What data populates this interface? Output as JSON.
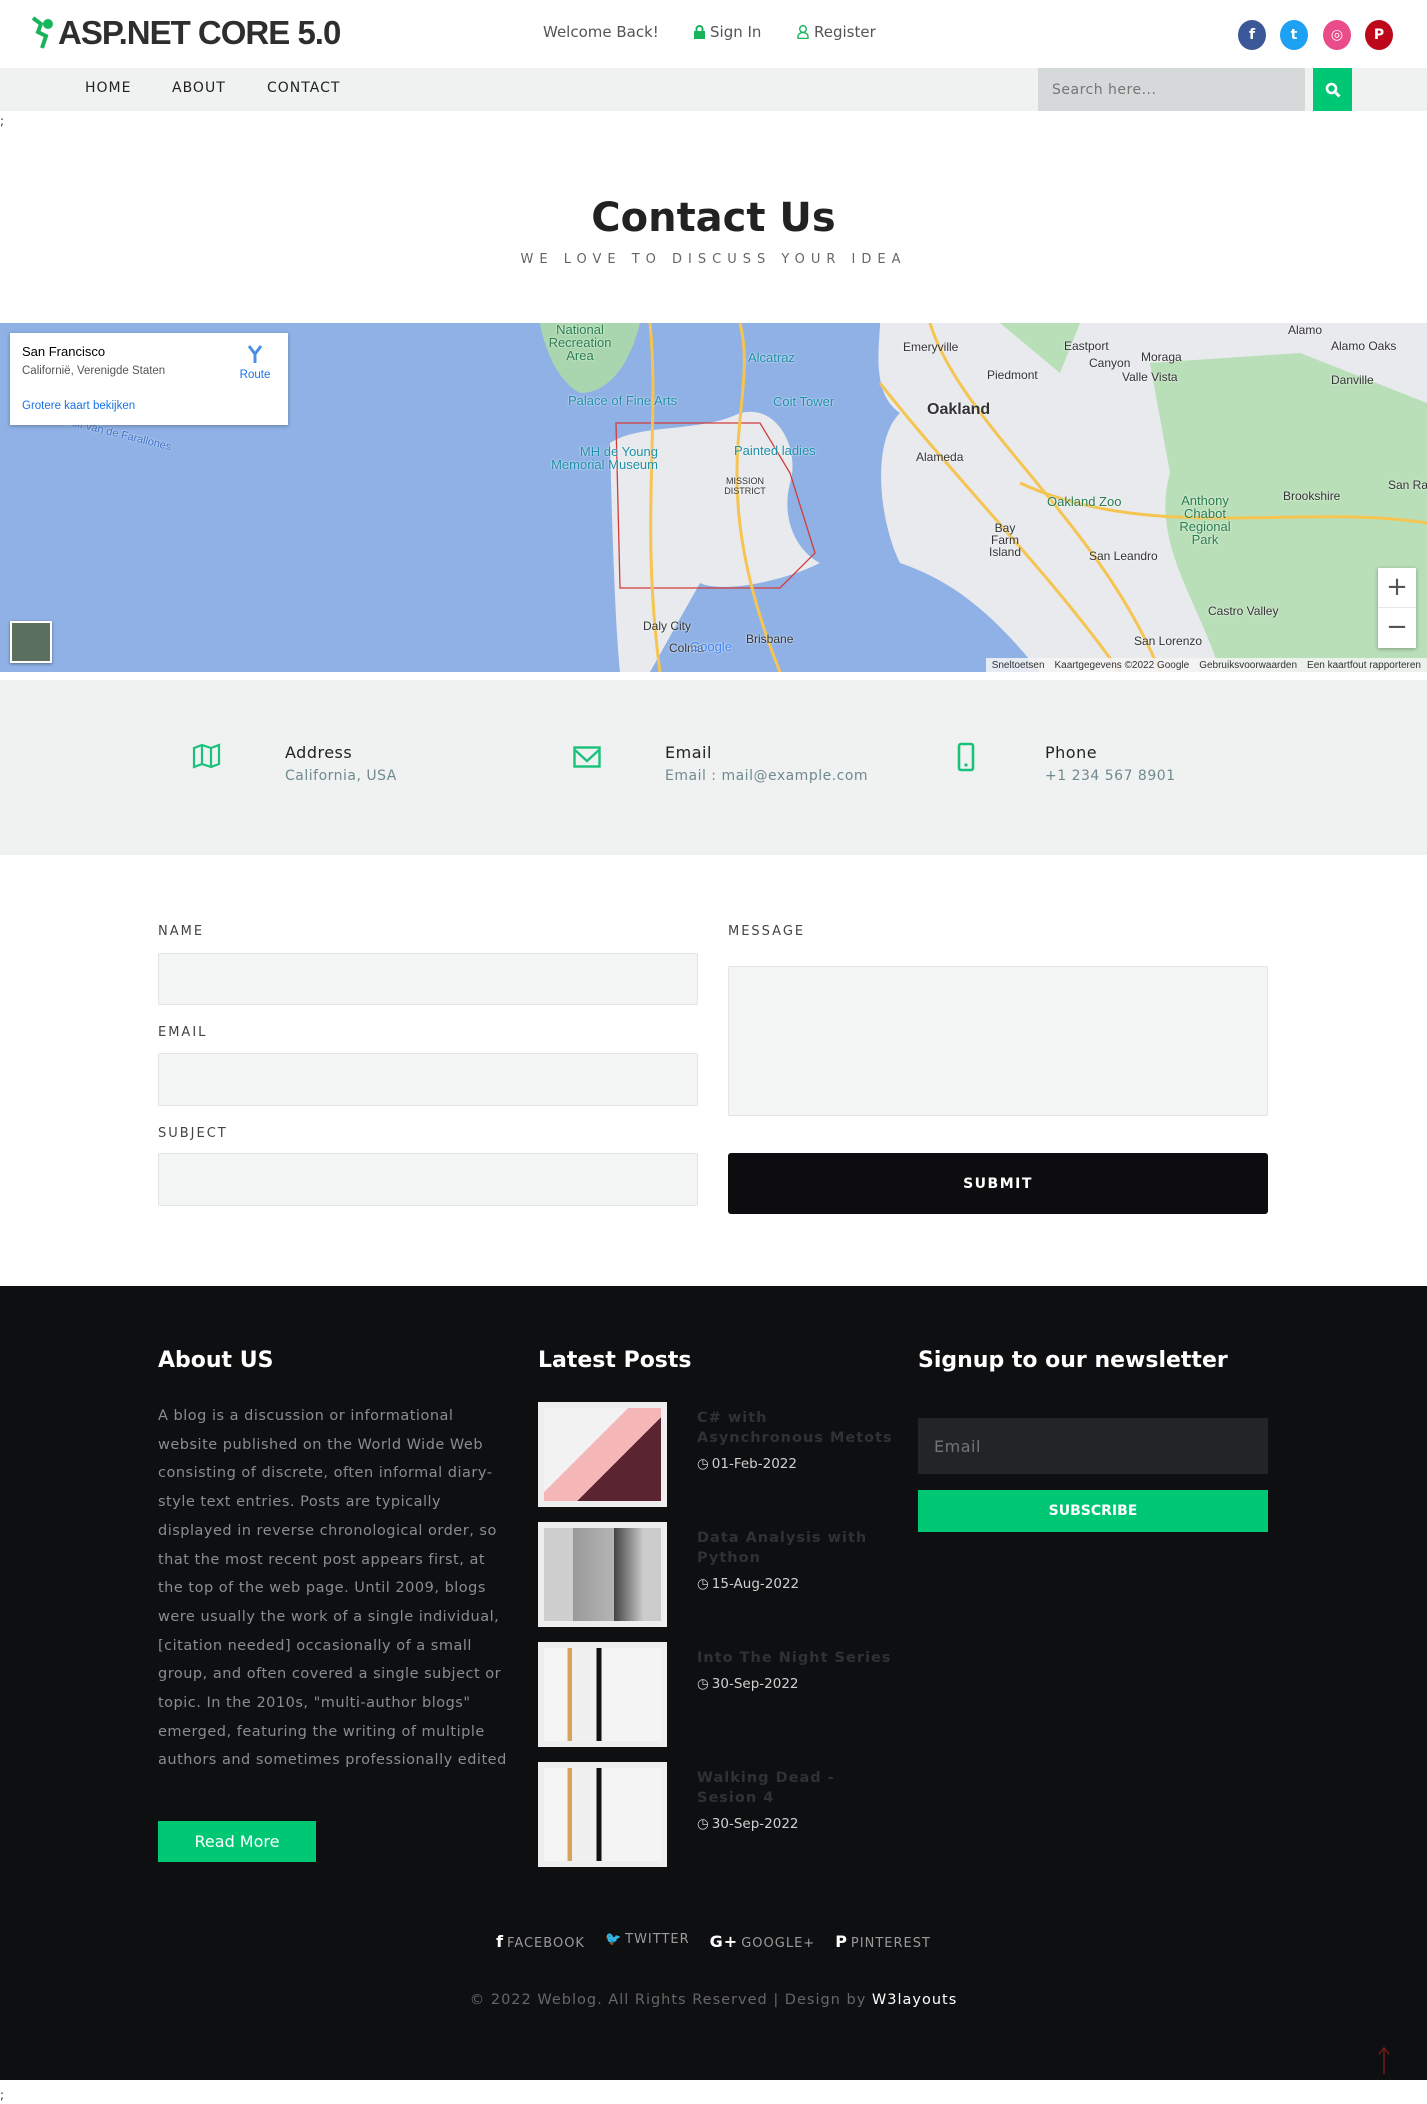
{
  "header": {
    "logo_text": "ASP.NET CORE 5.0",
    "welcome": "Welcome Back!",
    "sign_in": "Sign In",
    "register": "Register",
    "social": [
      {
        "name": "facebook",
        "glyph": "f",
        "color": "#3b5998"
      },
      {
        "name": "twitter",
        "glyph": "t",
        "color": "#1da1f2"
      },
      {
        "name": "dribbble",
        "glyph": "◎",
        "color": "#ea4c89"
      },
      {
        "name": "pinterest",
        "glyph": "P",
        "color": "#bd081c"
      }
    ]
  },
  "nav": {
    "items": [
      "HOME",
      "ABOUT",
      "CONTACT"
    ],
    "search_placeholder": "Search here..."
  },
  "stray": ";",
  "page": {
    "title": "Contact Us",
    "subtitle": "WE LOVE TO DISCUSS YOUR IDEA"
  },
  "map": {
    "place": "San Francisco",
    "region": "Californië, Verenigde Staten",
    "route": "Route",
    "bigger_map": "Grotere kaart bekijken",
    "labels": [
      "Golf van de Farallones",
      "National Recreation Area",
      "Alcatraz",
      "Palace of Fine Arts",
      "Coit Tower",
      "MH de Young Memorial Museum",
      "Painted ladies",
      "MISSION DISTRICT",
      "Emeryville",
      "Oakland",
      "Alameda",
      "Piedmont",
      "Eastport",
      "Moraga",
      "Canyon",
      "Valle Vista",
      "Alamo",
      "Alamo Oaks",
      "Danville",
      "Oakland Zoo",
      "Anthony Chabot Regional Park",
      "Brookshire",
      "Bay Farm Island",
      "San Leandro",
      "Castro Valley",
      "San Lorenzo",
      "Daly City",
      "Colma",
      "Brisbane",
      "San Ram"
    ],
    "attribution": [
      "Sneltoetsen",
      "Kaartgegevens ©2022 Google",
      "Gebruiksvoorwaarden",
      "Een kaartfout rapporteren"
    ],
    "zoom_in": "+",
    "zoom_out": "−",
    "google": "Google"
  },
  "info": [
    {
      "title": "Address",
      "value": "California, USA",
      "icon": "map-icon"
    },
    {
      "title": "Email",
      "value": "Email : mail@example.com",
      "icon": "envelope-icon"
    },
    {
      "title": "Phone",
      "value": "+1 234 567 8901",
      "icon": "mobile-icon"
    }
  ],
  "form": {
    "name_label": "NAME",
    "email_label": "EMAIL",
    "subject_label": "SUBJECT",
    "message_label": "MESSAGE",
    "submit": "SUBMIT"
  },
  "footer": {
    "about_title": "About US",
    "about_text": "A blog is a discussion or informational website published on the World Wide Web consisting of discrete, often informal diary-style text entries. Posts are typically displayed in reverse chronological order, so that the most recent post appears first, at the top of the web page. Until 2009, blogs were usually the work of a single individual,[citation needed] occasionally of a small group, and often covered a single subject or topic. In the 2010s, \"multi-author blogs\" emerged, featuring the writing of multiple authors and sometimes professionally edited",
    "read_more": "Read More",
    "posts_title": "Latest Posts",
    "posts": [
      {
        "title": "C# with Asynchronous Metots",
        "date": "01-Feb-2022"
      },
      {
        "title": "Data Analysis with Python",
        "date": "15-Aug-2022"
      },
      {
        "title": "Into The Night Series",
        "date": "30-Sep-2022"
      },
      {
        "title": "Walking Dead - Sesion 4",
        "date": "30-Sep-2022"
      }
    ],
    "newsletter_title": "Signup to our newsletter",
    "newsletter_placeholder": "Email",
    "subscribe": "SUBSCRIBE",
    "social": [
      {
        "glyph": "f",
        "label": "FACEBOOK"
      },
      {
        "glyph": "🐦",
        "label": "TWITTER"
      },
      {
        "glyph": "G+",
        "label": "GOOGLE+"
      },
      {
        "glyph": "P",
        "label": "PINTEREST"
      }
    ],
    "copyright": "© 2022 Weblog. All Rights Reserved | Design by",
    "designer": "W3layouts"
  },
  "colors": {
    "accent": "#00c774",
    "footer_bg": "#0e0f11",
    "light_bg": "#f0f2f1"
  }
}
